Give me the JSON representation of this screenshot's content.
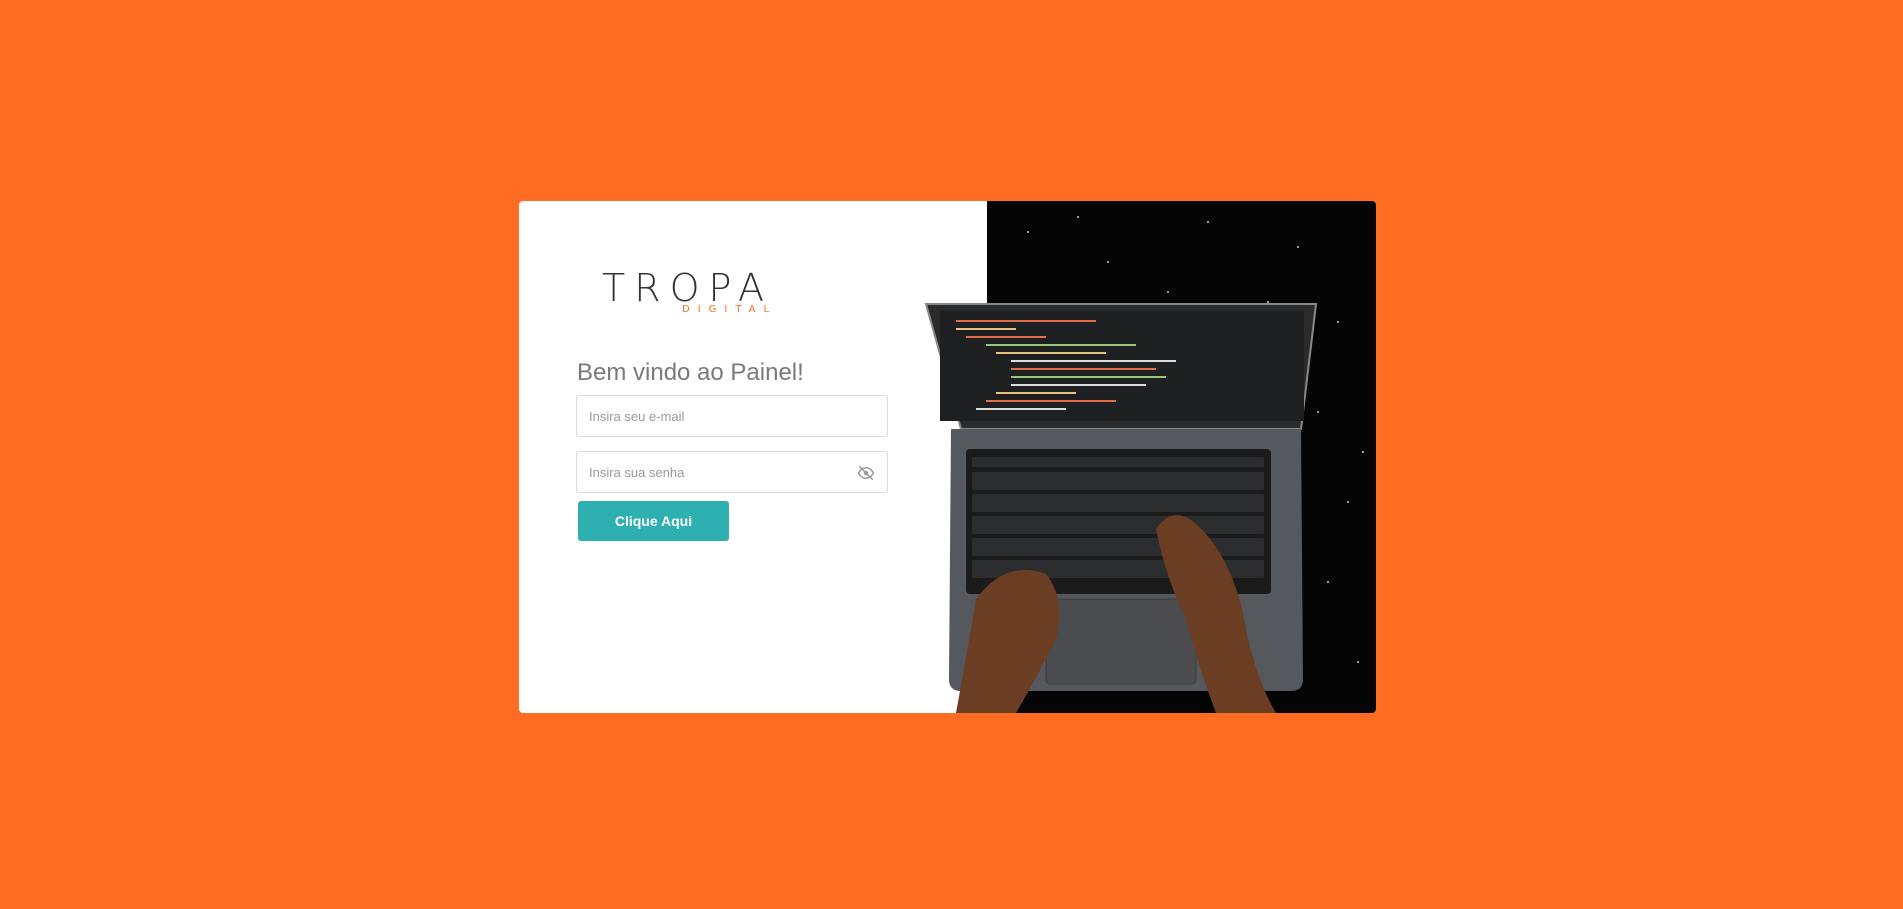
{
  "brand": {
    "logo_main": "TROPA",
    "logo_sub": "DIGITAL",
    "accent_color": "#ff6c22"
  },
  "login": {
    "title": "Bem vindo ao Painel!",
    "email_placeholder": "Insira seu e-mail",
    "password_placeholder": "Insira sua senha",
    "submit_label": "Clique Aqui",
    "button_color": "#2fb0b0"
  },
  "icons": {
    "password_toggle": "eye-slash-icon"
  }
}
